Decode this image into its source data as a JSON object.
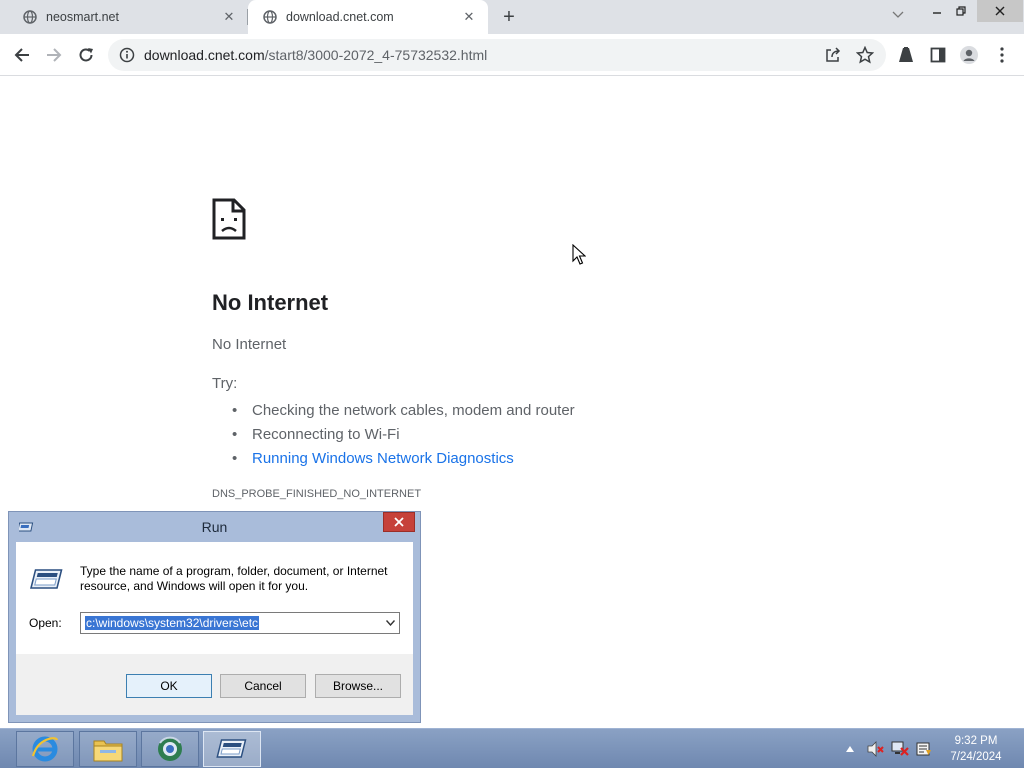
{
  "browser": {
    "tabs": [
      {
        "title": "neosmart.net",
        "active": false
      },
      {
        "title": "download.cnet.com",
        "active": true
      }
    ],
    "new_tab_symbol": "+",
    "url_host": "download.cnet.com",
    "url_path": "/start8/3000-2072_4-75732532.html"
  },
  "error_page": {
    "title": "No Internet",
    "subtitle": "No Internet",
    "try_label": "Try:",
    "suggestions": [
      "Checking the network cables, modem and router",
      "Reconnecting to Wi-Fi",
      "Running Windows Network Diagnostics"
    ],
    "error_code": "DNS_PROBE_FINISHED_NO_INTERNET"
  },
  "run_dialog": {
    "title": "Run",
    "description": "Type the name of a program, folder, document, or Internet resource, and Windows will open it for you.",
    "open_label": "Open:",
    "open_value": "c:\\windows\\system32\\drivers\\etc",
    "ok_label": "OK",
    "cancel_label": "Cancel",
    "browse_label": "Browse..."
  },
  "taskbar": {
    "time": "9:32 PM",
    "date": "7/24/2024",
    "items": [
      "internet-explorer-icon",
      "file-explorer-icon",
      "browser-globe-icon",
      "run-dialog-icon"
    ]
  },
  "colors": {
    "link": "#1a73e8",
    "taskbar": "#7a91b8",
    "dialog_frame": "#a9bcda",
    "close_red": "#c6413a"
  }
}
